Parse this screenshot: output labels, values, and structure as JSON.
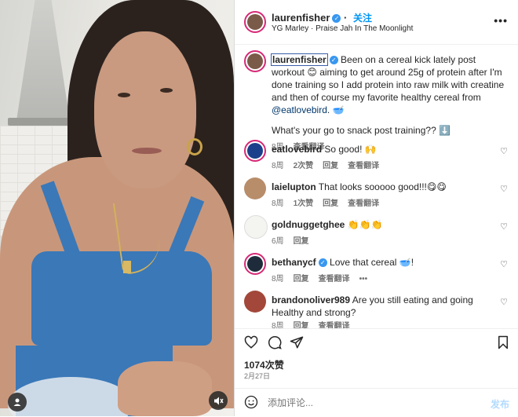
{
  "header": {
    "username": "laurenfisher",
    "follow_label": "关注",
    "song": "YG Marley · Praise Jah In The Moonlight",
    "more_label": "•••"
  },
  "caption": {
    "username": "laurenfisher",
    "text_1": "Been on a cereal kick lately post workout 😊 aiming to get around 25g of protein after I'm done training so I add protein into raw milk with creatine and then of course my favorite healthy cereal from ",
    "mention": "@eatlovebird",
    "text_2": ". 🥣",
    "question": "What's your go to snack post training?? ⬇️",
    "time": "8周",
    "translate": "查看翻译"
  },
  "comments": [
    {
      "username": "eatlovebird",
      "verified": false,
      "text": "So good! 🙌",
      "time": "8周",
      "likes": "2次赞",
      "reply": "回复",
      "translate": "查看翻译",
      "avatar_color": "#1b3f8a"
    },
    {
      "username": "laielupton",
      "verified": false,
      "text": "That looks sooooo good!!!😋😋",
      "time": "8周",
      "likes": "1次赞",
      "reply": "回复",
      "translate": "查看翻译",
      "avatar_color": "#b88d6a"
    },
    {
      "username": "goldnuggetghee",
      "verified": false,
      "text": "👏👏👏",
      "time": "6周",
      "likes": "",
      "reply": "回复",
      "translate": "",
      "avatar_color": "#2a2a2a"
    },
    {
      "username": "bethanycf",
      "verified": true,
      "text": "Love that cereal 🥣!",
      "time": "8周",
      "likes": "",
      "reply": "回复",
      "translate": "查看翻译",
      "extra": "•••",
      "avatar_color": "#1e2b3a"
    },
    {
      "username": "brandonoliver989",
      "verified": false,
      "text": "Are you still eating and going Healthy and strong?",
      "time": "8周",
      "likes": "",
      "reply": "回复",
      "translate": "查看翻译",
      "avatar_color": "#a3473a"
    }
  ],
  "actions": {
    "likes": "1074次赞",
    "date": "2月27日"
  },
  "add_comment": {
    "placeholder": "添加评论...",
    "post_label": "发布"
  },
  "icons": {
    "heart": "heart-icon",
    "comment": "comment-icon",
    "share": "share-icon",
    "bookmark": "bookmark-icon",
    "emoji": "emoji-icon",
    "mute": "mute-icon",
    "user": "user-tag-icon"
  }
}
